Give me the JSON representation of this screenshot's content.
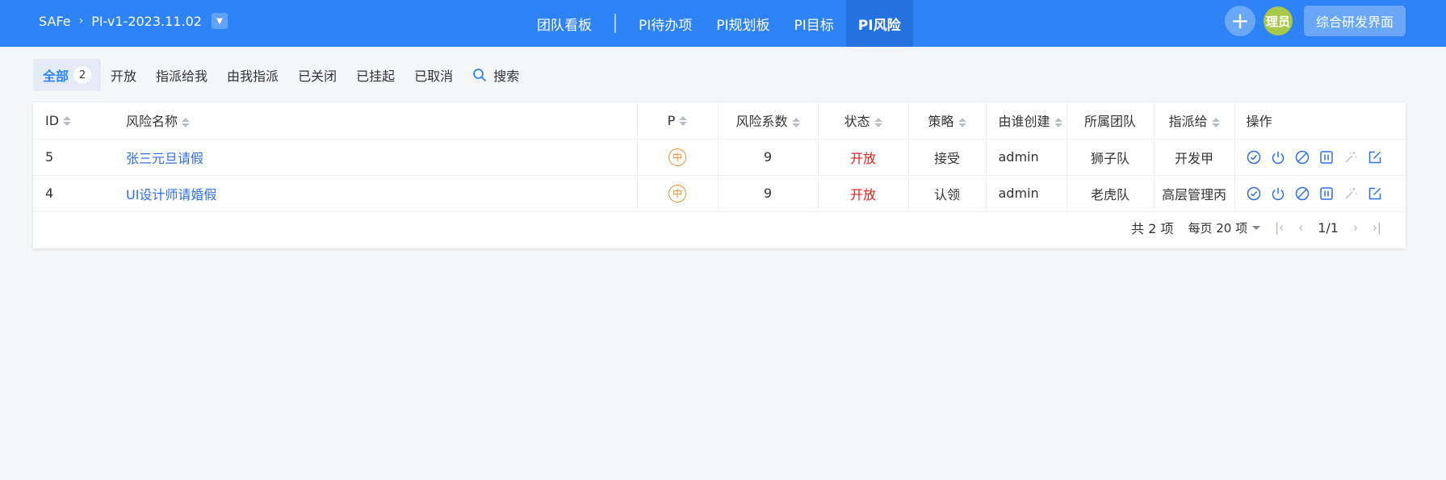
{
  "header": {
    "breadcrumb": {
      "root": "SAFe",
      "separator": "›",
      "current": "PI-v1-2023.11.02"
    },
    "nav": [
      {
        "label": "团队看板"
      },
      {
        "label": "PI待办项"
      },
      {
        "label": "PI规划板"
      },
      {
        "label": "PI目标"
      },
      {
        "label": "PI风险",
        "active": true
      }
    ],
    "avatar_text": "理员",
    "dev_button": "综合研发界面",
    "accent": "#2e83f7"
  },
  "filters": {
    "items": [
      "全部",
      "开放",
      "指派给我",
      "由我指派",
      "已关闭",
      "已挂起",
      "已取消"
    ],
    "all_count": "2",
    "search_label": "搜索"
  },
  "table": {
    "columns": {
      "id": "ID",
      "name": "风险名称",
      "p": "P",
      "coef": "风险系数",
      "status": "状态",
      "strategy": "策略",
      "creator": "由谁创建",
      "team": "所属团队",
      "assignee": "指派给",
      "ops": "操作"
    },
    "rows": [
      {
        "id": "5",
        "name": "张三元旦请假",
        "p": "中",
        "coef": "9",
        "status": "开放",
        "strategy": "接受",
        "creator": "admin",
        "team": "狮子队",
        "assignee": "开发甲"
      },
      {
        "id": "4",
        "name": "UI设计师请婚假",
        "p": "中",
        "coef": "9",
        "status": "开放",
        "strategy": "认领",
        "creator": "admin",
        "team": "老虎队",
        "assignee": "高层管理丙"
      }
    ],
    "op_icons": [
      "check-circle-icon",
      "power-icon",
      "ban-icon",
      "pause-icon",
      "magic-wand-icon",
      "edit-icon"
    ]
  },
  "pager": {
    "total": "共 2 项",
    "per_page": "每页 20 项",
    "page": "1/1"
  }
}
